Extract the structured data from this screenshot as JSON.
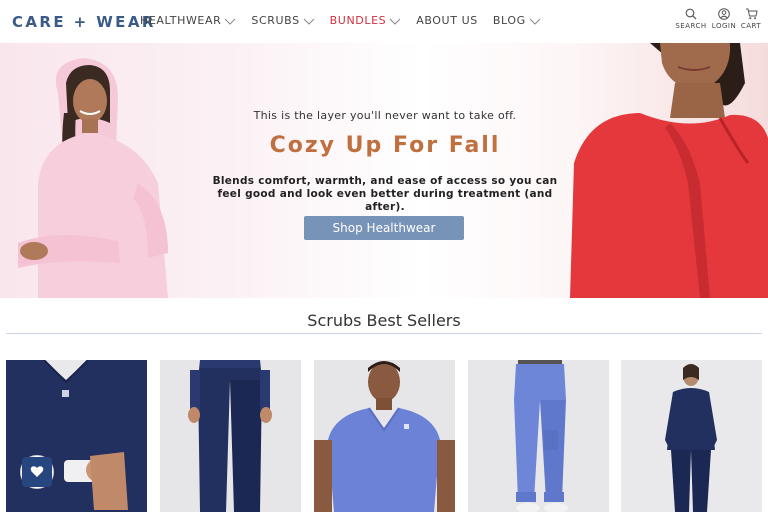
{
  "brand": {
    "logo_text": "CARE + WEAR"
  },
  "nav": {
    "items": [
      {
        "label": "HEALTHWEAR",
        "has_dropdown": true
      },
      {
        "label": "SCRUBS",
        "has_dropdown": true
      },
      {
        "label": "BUNDLES",
        "has_dropdown": true,
        "color": "#d22f3f"
      },
      {
        "label": "ABOUT US",
        "has_dropdown": false
      },
      {
        "label": "BLOG",
        "has_dropdown": true
      }
    ]
  },
  "utility": {
    "search": {
      "label": "SEARCH",
      "icon": "search-icon"
    },
    "login": {
      "label": "LOGIN",
      "icon": "user-icon"
    },
    "cart": {
      "label": "CART",
      "icon": "cart-icon"
    }
  },
  "hero": {
    "kicker": "This is the layer you'll never want to take off.",
    "title": "Cozy Up For Fall",
    "description": "Blends comfort, warmth, and ease of access so you can feel good and look even better during treatment (and after).",
    "button_label": "Shop Healthwear",
    "colors": {
      "title": "#c0703e",
      "button": "#7893b8"
    }
  },
  "section": {
    "title": "Scrubs Best Sellers"
  },
  "products": [
    {
      "name": "navy scrub top with pocket",
      "color": "#1f2b5e"
    },
    {
      "name": "navy jogger pants",
      "color": "#1f2b5e"
    },
    {
      "name": "ceil blue v-neck scrub top",
      "color": "#6f86d6"
    },
    {
      "name": "ceil blue jogger pants",
      "color": "#6f86d6"
    },
    {
      "name": "navy long sleeve set",
      "color": "#1f2b5e"
    }
  ],
  "wishlist": {
    "icon": "heart-icon"
  }
}
